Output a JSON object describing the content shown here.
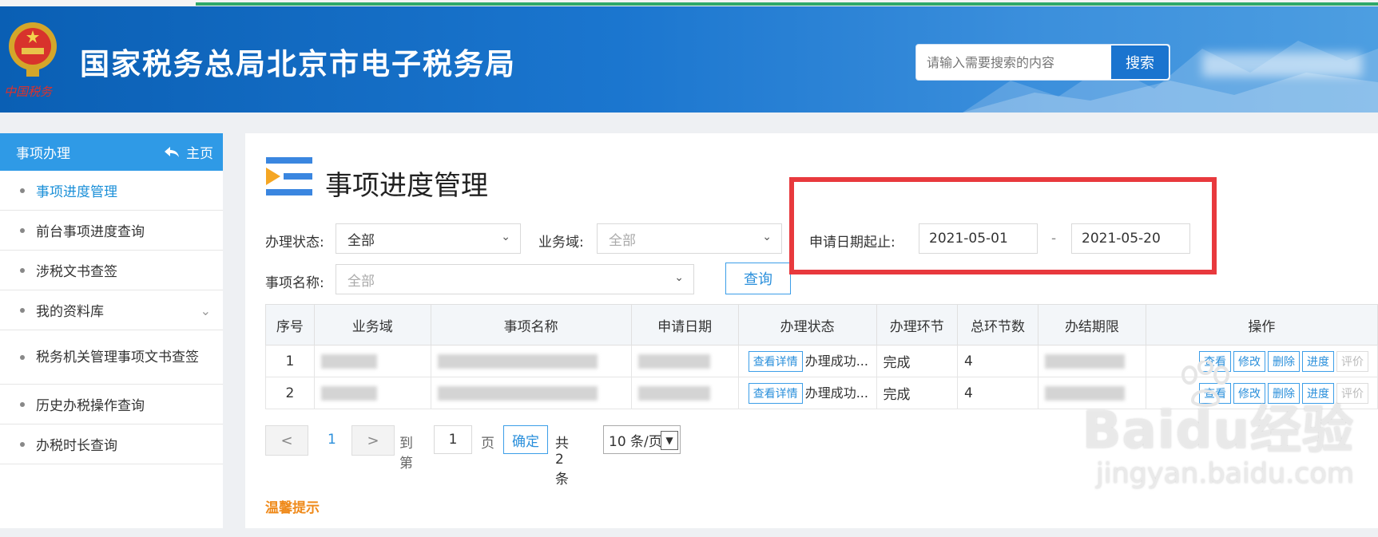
{
  "header": {
    "emblem_text": "中国税务",
    "site_title": "国家税务总局北京市电子税务局",
    "search_placeholder": "请输入需要搜索的内容",
    "search_button": "搜索"
  },
  "sidebar": {
    "title": "事项办理",
    "home_label": "主页",
    "items": [
      {
        "label": "事项进度管理",
        "active": true
      },
      {
        "label": "前台事项进度查询"
      },
      {
        "label": "涉税文书查签"
      },
      {
        "label": "我的资料库",
        "expandable": true
      },
      {
        "label": "税务机关管理事项文书查签"
      },
      {
        "label": "历史办税操作查询"
      },
      {
        "label": "办税时长查询"
      }
    ]
  },
  "main": {
    "title": "事项进度管理",
    "filters": {
      "status_label": "办理状态:",
      "status_value": "全部",
      "domain_label": "业务域:",
      "domain_placeholder": "全部",
      "date_label": "申请日期起止:",
      "date_from": "2021-05-01",
      "date_sep": "-",
      "date_to": "2021-05-20",
      "name_label": "事项名称:",
      "name_placeholder": "全部",
      "query_button": "查询"
    },
    "table": {
      "headers": [
        "序号",
        "业务域",
        "事项名称",
        "申请日期",
        "办理状态",
        "办理环节",
        "总环节数",
        "办结期限",
        "操作"
      ],
      "rows": [
        {
          "no": "1",
          "detail_button": "查看详情",
          "status": "办理成功...",
          "stage": "完成",
          "total": "4"
        },
        {
          "no": "2",
          "detail_button": "查看详情",
          "status": "办理成功...",
          "stage": "完成",
          "total": "4"
        }
      ],
      "actions": [
        "查看",
        "修改",
        "删除",
        "进度",
        "评价"
      ]
    },
    "pager": {
      "prev": "<",
      "current": "1",
      "next": ">",
      "goto_label": "到第",
      "goto_value": "1",
      "page_unit": "页",
      "confirm": "确定",
      "total": "共 2 条",
      "page_size": "10 条/页"
    },
    "tip_title": "温馨提示"
  },
  "watermark": {
    "brand": "Baidu经验",
    "url": "jingyan.baidu.com"
  },
  "colors": {
    "header_blue": "#1b76cf",
    "accent": "#2f9ae6",
    "highlight_red": "#e8393d",
    "tip_orange": "#ef8a1b"
  }
}
